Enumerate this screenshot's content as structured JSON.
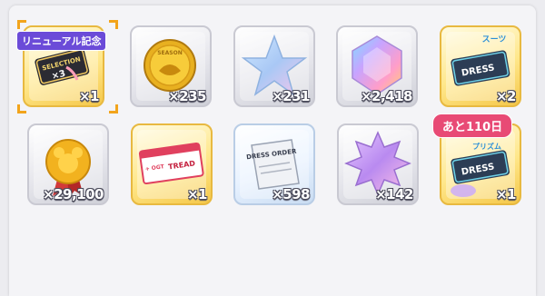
{
  "badges": {
    "renewal": "リニューアル記念",
    "remaining": "あと110日"
  },
  "items": [
    {
      "name": "selection-ticket",
      "count": "×1",
      "art_text": "SELECTION",
      "art_num": "×3"
    },
    {
      "name": "season-coin",
      "count": "×235",
      "art_text": "SEASON"
    },
    {
      "name": "silver-star",
      "count": "×231"
    },
    {
      "name": "rainbow-gem",
      "count": "×2,418"
    },
    {
      "name": "dress-ticket-suit",
      "count": "×2",
      "art_text": "DRESS",
      "art_tag": "スーツ"
    },
    {
      "name": "gold-medal",
      "count": "×29,100"
    },
    {
      "name": "tread-ticket",
      "count": "×1",
      "art_text": "TREAD",
      "art_sub": "+ OGT"
    },
    {
      "name": "dress-order",
      "count": "×598",
      "art_text": "DRESS ORDER"
    },
    {
      "name": "purple-star",
      "count": "×142"
    },
    {
      "name": "dress-ticket-prism",
      "count": "×1",
      "art_text": "DRESS",
      "art_tag": "プリズム"
    }
  ],
  "colors": {
    "gold_frame": "#e8b940",
    "silver_frame": "#c9c9d2",
    "renewal_badge": "#6b4bd8",
    "remaining_badge": "#e84a75"
  }
}
